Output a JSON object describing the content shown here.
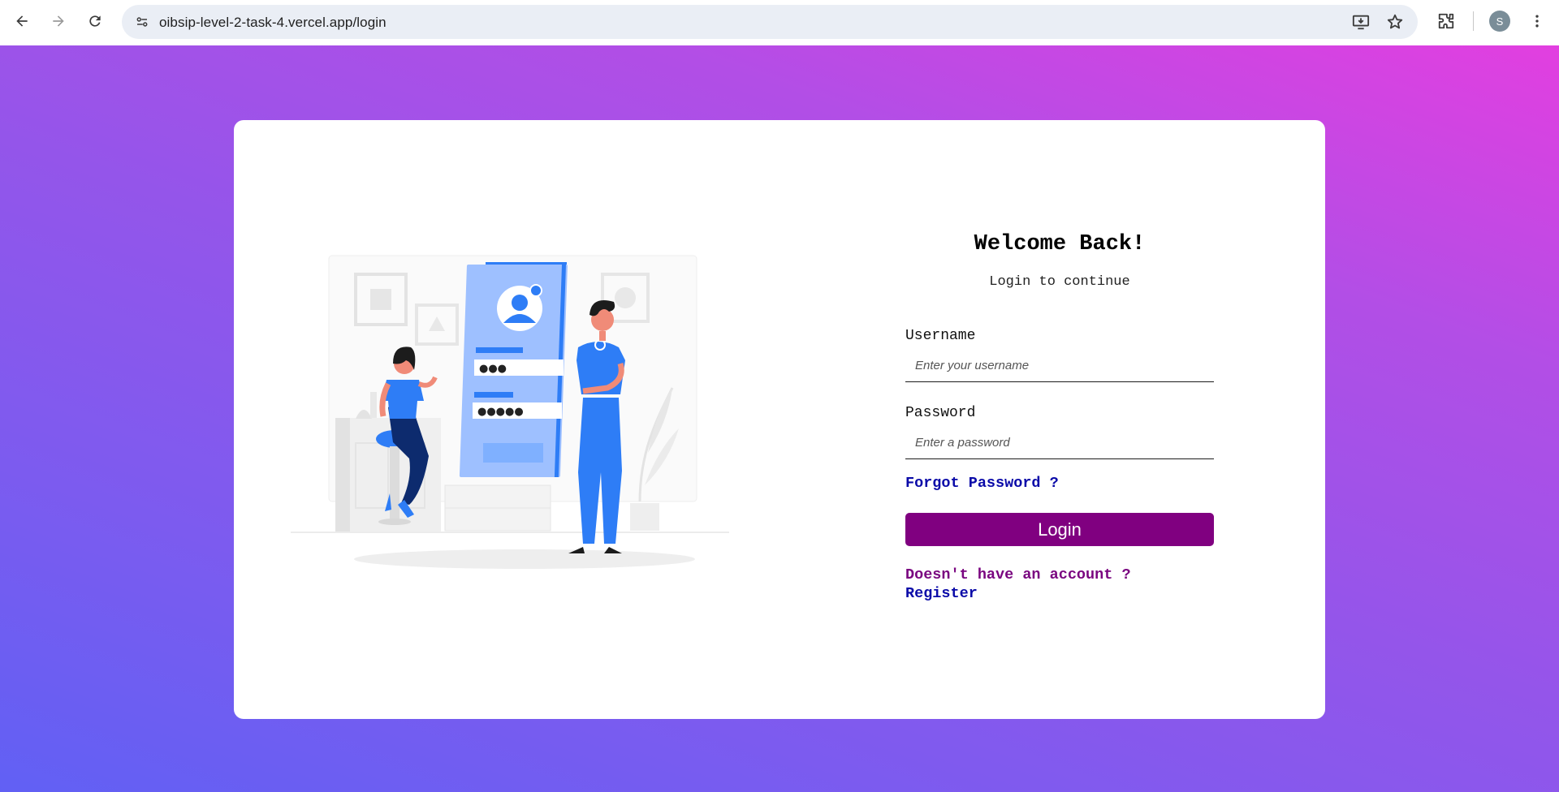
{
  "browser": {
    "url": "oibsip-level-2-task-4.vercel.app/login",
    "profile_initial": "S",
    "icons": [
      "back-arrow-icon",
      "forward-arrow-icon",
      "reload-icon",
      "site-info-icon",
      "install-app-icon",
      "bookmark-star-icon",
      "extensions-icon",
      "more-menu-icon"
    ]
  },
  "page": {
    "background_colors": [
      "#e23fe0",
      "#9455ea",
      "#6160f4"
    ]
  },
  "login": {
    "title": "Welcome Back!",
    "subtitle": "Login to continue",
    "username_label": "Username",
    "username_placeholder": "Enter your username",
    "password_label": "Password",
    "password_placeholder": "Enter a password",
    "forgot_password": "Forgot Password ?",
    "login_button": "Login",
    "no_account_text": "Doesn't have an account ?",
    "register_link": "Register",
    "button_color": "#800080",
    "link_color": "#0a0aa8"
  },
  "illustration": {
    "name": "login-illustration",
    "password_dots_1": "●●●",
    "password_dots_2": "●●●●●"
  }
}
